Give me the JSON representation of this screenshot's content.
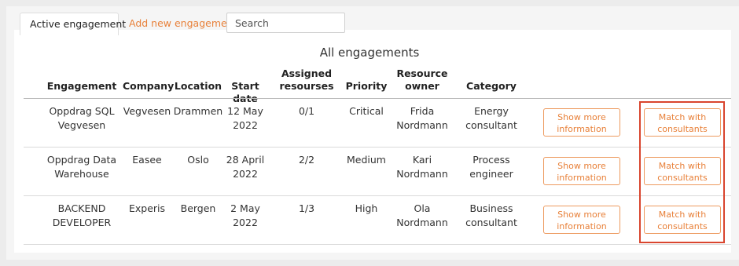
{
  "tabs": {
    "active": "Active engagement",
    "add": "Add new engagement"
  },
  "search": {
    "placeholder": "Search",
    "value": ""
  },
  "table": {
    "title": "All engagements",
    "headers": {
      "engagement": "Engagement",
      "company": "Company",
      "location": "Location",
      "start_date": "Start date",
      "assigned_1": "Assigned",
      "assigned_2": "resourses",
      "priority": "Priority",
      "owner_1": "Resource",
      "owner_2": "owner",
      "category": "Category"
    },
    "rows": [
      {
        "engagement_1": "Oppdrag SQL",
        "engagement_2": "Vegvesen",
        "company": "Vegvesen",
        "location": "Drammen",
        "date_1": "12 May",
        "date_2": "2022",
        "assigned": "0/1",
        "priority": "Critical",
        "owner_1": "Frida",
        "owner_2": "Nordmann",
        "category_1": "Energy",
        "category_2": "consultant",
        "info_1": "Show more",
        "info_2": "information",
        "match_1": "Match with",
        "match_2": "consultants"
      },
      {
        "engagement_1": "Oppdrag Data",
        "engagement_2": "Warehouse",
        "company": "Easee",
        "location": "Oslo",
        "date_1": "28 April",
        "date_2": "2022",
        "assigned": "2/2",
        "priority": "Medium",
        "owner_1": "Kari",
        "owner_2": "Nordmann",
        "category_1": "Process",
        "category_2": "engineer",
        "info_1": "Show more",
        "info_2": "information",
        "match_1": "Match with",
        "match_2": "consultants"
      },
      {
        "engagement_1": "BACKEND",
        "engagement_2": "DEVELOPER",
        "company": "Experis",
        "location": "Bergen",
        "date_1": "2 May",
        "date_2": "2022",
        "assigned": "1/3",
        "priority": "High",
        "owner_1": "Ola",
        "owner_2": "Nordmann",
        "category_1": "Business",
        "category_2": "consultant",
        "info_1": "Show more",
        "info_2": "information",
        "match_1": "Match with",
        "match_2": "consultants"
      }
    ]
  },
  "colors": {
    "accent": "#e8813a",
    "highlight": "#d9452e"
  }
}
